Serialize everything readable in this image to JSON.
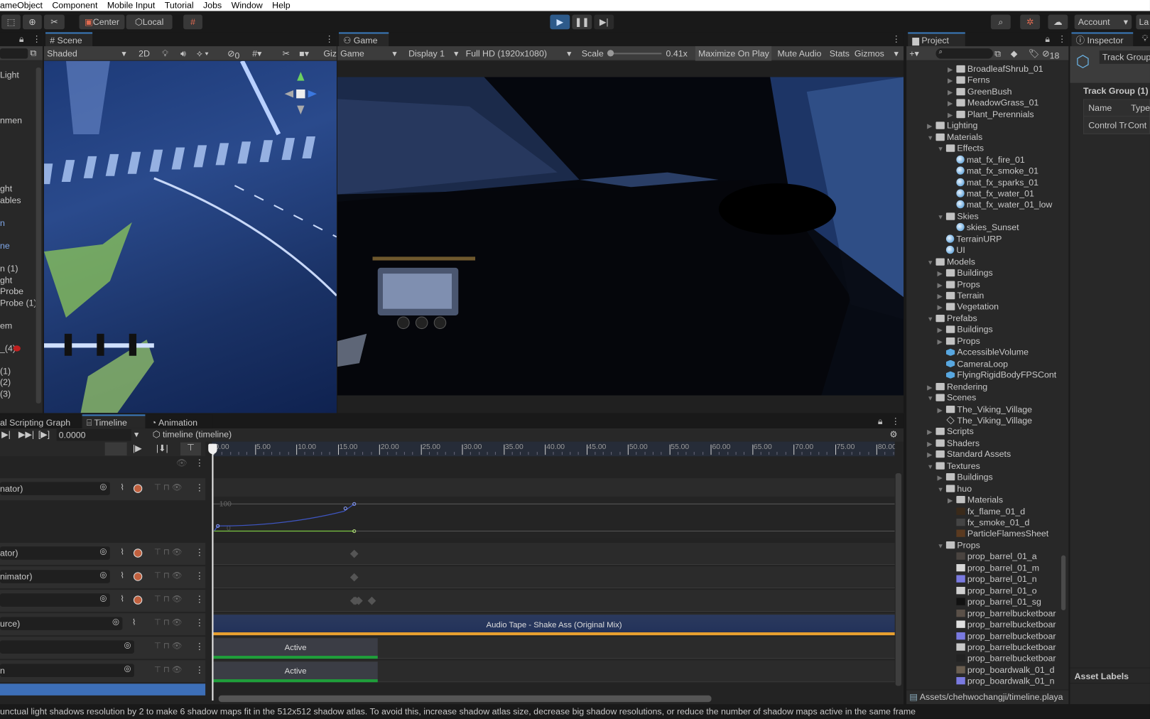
{
  "menu": [
    "ameObject",
    "Component",
    "Mobile Input",
    "Tutorial",
    "Jobs",
    "Window",
    "Help"
  ],
  "toolbar": {
    "center": "Center",
    "local": "Local",
    "account": "Account",
    "layers": "La"
  },
  "hierarchy": {
    "items": [
      "Light",
      "nmen",
      "ght",
      "ables",
      "n",
      "ne",
      "n (1)",
      "ght",
      "Probe",
      "Probe (1)",
      "em",
      "_(4)",
      "(1)",
      "(2)",
      "(3)"
    ]
  },
  "scene": {
    "tab": "Scene",
    "shading": "Shaded",
    "mode2d": "2D",
    "hidden_count": "0",
    "gizmos": "Giz"
  },
  "game": {
    "tab": "Game",
    "view": "Game",
    "display": "Display 1",
    "resolution": "Full HD (1920x1080)",
    "scale_label": "Scale",
    "scale_value": "0.41x",
    "scale_fraction": 0.0,
    "maximize": "Maximize On Play",
    "mute": "Mute Audio",
    "stats": "Stats",
    "gizmos": "Gizmos"
  },
  "project": {
    "tab": "Project",
    "hidden_count": "18",
    "path": "Assets/chehwochangji/timeline.playa",
    "tree": [
      {
        "d": 3,
        "a": "r",
        "i": "folder",
        "t": "BroadleafShrub_01"
      },
      {
        "d": 3,
        "a": "r",
        "i": "folder",
        "t": "Ferns"
      },
      {
        "d": 3,
        "a": "r",
        "i": "folder",
        "t": "GreenBush"
      },
      {
        "d": 3,
        "a": "r",
        "i": "folder",
        "t": "MeadowGrass_01"
      },
      {
        "d": 3,
        "a": "r",
        "i": "folder",
        "t": "Plant_Perennials"
      },
      {
        "d": 1,
        "a": "r",
        "i": "folder",
        "t": "Lighting"
      },
      {
        "d": 1,
        "a": "d",
        "i": "folder",
        "t": "Materials"
      },
      {
        "d": 2,
        "a": "d",
        "i": "folder",
        "t": "Effects"
      },
      {
        "d": 3,
        "a": "",
        "i": "mat",
        "t": "mat_fx_fire_01"
      },
      {
        "d": 3,
        "a": "",
        "i": "mat",
        "t": "mat_fx_smoke_01"
      },
      {
        "d": 3,
        "a": "",
        "i": "mat",
        "t": "mat_fx_sparks_01"
      },
      {
        "d": 3,
        "a": "",
        "i": "mat",
        "t": "mat_fx_water_01"
      },
      {
        "d": 3,
        "a": "",
        "i": "mat",
        "t": "mat_fx_water_01_low"
      },
      {
        "d": 2,
        "a": "d",
        "i": "folder",
        "t": "Skies"
      },
      {
        "d": 3,
        "a": "",
        "i": "mat",
        "t": "skies_Sunset"
      },
      {
        "d": 2,
        "a": "",
        "i": "mat",
        "t": "TerrainURP"
      },
      {
        "d": 2,
        "a": "",
        "i": "mat",
        "t": "UI"
      },
      {
        "d": 1,
        "a": "d",
        "i": "folder",
        "t": "Models"
      },
      {
        "d": 2,
        "a": "r",
        "i": "folder",
        "t": "Buildings"
      },
      {
        "d": 2,
        "a": "r",
        "i": "folder",
        "t": "Props"
      },
      {
        "d": 2,
        "a": "r",
        "i": "folder",
        "t": "Terrain"
      },
      {
        "d": 2,
        "a": "r",
        "i": "folder",
        "t": "Vegetation"
      },
      {
        "d": 1,
        "a": "d",
        "i": "folder",
        "t": "Prefabs"
      },
      {
        "d": 2,
        "a": "r",
        "i": "folder",
        "t": "Buildings"
      },
      {
        "d": 2,
        "a": "r",
        "i": "folder",
        "t": "Props"
      },
      {
        "d": 2,
        "a": "",
        "i": "prefab",
        "t": "AccessibleVolume"
      },
      {
        "d": 2,
        "a": "",
        "i": "prefab",
        "t": "CameraLoop"
      },
      {
        "d": 2,
        "a": "",
        "i": "prefab",
        "t": "FlyingRigidBodyFPSCont"
      },
      {
        "d": 1,
        "a": "r",
        "i": "folder",
        "t": "Rendering"
      },
      {
        "d": 1,
        "a": "d",
        "i": "folder",
        "t": "Scenes"
      },
      {
        "d": 2,
        "a": "r",
        "i": "folder",
        "t": "The_Viking_Village"
      },
      {
        "d": 2,
        "a": "",
        "i": "scene",
        "t": "The_Viking_Village"
      },
      {
        "d": 1,
        "a": "r",
        "i": "folder",
        "t": "Scripts"
      },
      {
        "d": 1,
        "a": "r",
        "i": "folder",
        "t": "Shaders"
      },
      {
        "d": 1,
        "a": "r",
        "i": "folder",
        "t": "Standard Assets"
      },
      {
        "d": 1,
        "a": "d",
        "i": "folder",
        "t": "Textures"
      },
      {
        "d": 2,
        "a": "r",
        "i": "folder",
        "t": "Buildings"
      },
      {
        "d": 2,
        "a": "d",
        "i": "folder",
        "t": "huo"
      },
      {
        "d": 3,
        "a": "r",
        "i": "folder",
        "t": "Materials"
      },
      {
        "d": 3,
        "a": "",
        "i": "tex",
        "t": "fx_flame_01_d",
        "c": "#3a2a1a"
      },
      {
        "d": 3,
        "a": "",
        "i": "tex",
        "t": "fx_smoke_01_d",
        "c": "#444"
      },
      {
        "d": 3,
        "a": "",
        "i": "tex",
        "t": "ParticleFlamesSheet",
        "c": "#5a3a20"
      },
      {
        "d": 2,
        "a": "d",
        "i": "folder",
        "t": "Props"
      },
      {
        "d": 3,
        "a": "",
        "i": "tex",
        "t": "prop_barrel_01_a",
        "c": "#4a4440"
      },
      {
        "d": 3,
        "a": "",
        "i": "tex",
        "t": "prop_barrel_01_m",
        "c": "#d8d8d8"
      },
      {
        "d": 3,
        "a": "",
        "i": "tex",
        "t": "prop_barrel_01_n",
        "c": "#7a7ae0"
      },
      {
        "d": 3,
        "a": "",
        "i": "tex",
        "t": "prop_barrel_01_o",
        "c": "#d0d0d0"
      },
      {
        "d": 3,
        "a": "",
        "i": "tex",
        "t": "prop_barrel_01_sg",
        "c": "#111"
      },
      {
        "d": 3,
        "a": "",
        "i": "tex",
        "t": "prop_barrelbucketboar",
        "c": "#5a5048"
      },
      {
        "d": 3,
        "a": "",
        "i": "tex",
        "t": "prop_barrelbucketboar",
        "c": "#e0e0e0"
      },
      {
        "d": 3,
        "a": "",
        "i": "tex",
        "t": "prop_barrelbucketboar",
        "c": "#7a7ae0"
      },
      {
        "d": 3,
        "a": "",
        "i": "tex",
        "t": "prop_barrelbucketboar",
        "c": "#c8c8c8"
      },
      {
        "d": 3,
        "a": "",
        "i": "tex",
        "t": "prop_barrelbucketboar",
        "c": "#222"
      },
      {
        "d": 3,
        "a": "",
        "i": "tex",
        "t": "prop_boardwalk_01_d",
        "c": "#6a5e50"
      },
      {
        "d": 3,
        "a": "",
        "i": "tex",
        "t": "prop_boardwalk_01_n",
        "c": "#7a7ae0"
      }
    ]
  },
  "inspector": {
    "tab": "Inspector",
    "object_name": "Track Group",
    "header": "Track Group (1)",
    "col_name": "Name",
    "col_type": "Type",
    "row_name": "Control Tr",
    "row_type": "Cont",
    "asset_labels": "Asset Labels"
  },
  "timeline": {
    "tabs": [
      "al Scripting Graph",
      "Timeline",
      "Animation"
    ],
    "time": "0.0000",
    "asset": "timeline (timeline)",
    "ruler": [
      "0.00",
      "5.00",
      "10.00",
      "15.00",
      "20.00",
      "25.00",
      "30.00",
      "35.00",
      "40.00",
      "45.00",
      "50.00",
      "55.00",
      "60.00",
      "65.00",
      "70.00",
      "75.00",
      "80.00"
    ],
    "curve_max": "100",
    "curve_min": "0",
    "tracks": [
      {
        "label": "nator)",
        "kind": "anim"
      },
      {
        "label": "ator)",
        "kind": "anim"
      },
      {
        "label": "nimator)",
        "kind": "anim"
      },
      {
        "label": "",
        "kind": "anim"
      },
      {
        "label": "urce)",
        "kind": "audio"
      },
      {
        "label": "",
        "kind": "activation"
      },
      {
        "label": "n",
        "kind": "activation"
      }
    ],
    "audio_clip": "Audio Tape - Shake Ass (Original Mix)",
    "active_clip": "Active"
  },
  "status": "unctual light shadows resolution by 2 to make 6 shadow maps fit in the 512x512 shadow atlas. To avoid this, increase shadow atlas size, decrease big shadow resolutions, or reduce the number of shadow maps active in the same frame",
  "colors": {
    "accent": "#3a79bb",
    "audio": "#e8a030",
    "active": "#1f9e3a",
    "curve_blue": "#3e55c0",
    "curve_green": "#7cc843"
  }
}
